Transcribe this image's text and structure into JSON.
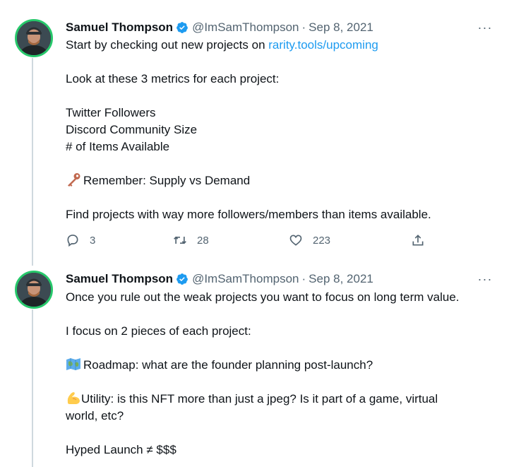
{
  "tweets": [
    {
      "author": {
        "name": "Samuel Thompson",
        "handle": "@ImSamThompson",
        "date": "Sep 8, 2021"
      },
      "more_label": "···",
      "lines": [
        {
          "text": "Start by checking out new projects on ",
          "link": "rarity.tools/upcoming"
        },
        {
          "text": ""
        },
        {
          "text": "Look at these 3 metrics for each project:"
        },
        {
          "text": ""
        },
        {
          "text": "Twitter Followers"
        },
        {
          "text": "Discord Community Size"
        },
        {
          "text": "# of Items Available"
        },
        {
          "text": ""
        },
        {
          "emoji": "key-emoji",
          "text": "Remember: Supply vs Demand"
        },
        {
          "text": ""
        },
        {
          "text": "Find projects with way more followers/members than items available."
        }
      ],
      "actions": {
        "replies": "3",
        "retweets": "28",
        "likes": "223"
      }
    },
    {
      "author": {
        "name": "Samuel Thompson",
        "handle": "@ImSamThompson",
        "date": "Sep 8, 2021"
      },
      "more_label": "···",
      "lines": [
        {
          "text": "Once you rule out the weak projects you want to focus on long term value."
        },
        {
          "text": ""
        },
        {
          "text": "I focus on 2 pieces of each project:"
        },
        {
          "text": ""
        },
        {
          "emoji": "map-emoji",
          "text": "Roadmap: what are the founder planning post-launch?"
        },
        {
          "text": ""
        },
        {
          "emoji": "flexed-biceps-emoji",
          "text": "Utility: is this NFT more than just a jpeg? Is it part of a game, virtual"
        },
        {
          "text": "world, etc?"
        },
        {
          "text": ""
        },
        {
          "text": "Hyped Launch ≠ $$$"
        }
      ]
    }
  ],
  "colors": {
    "link": "#1d9bf0",
    "verified": "#1d9bf0",
    "avatar_ring": "#27c86b",
    "secondary_text": "#536471"
  }
}
